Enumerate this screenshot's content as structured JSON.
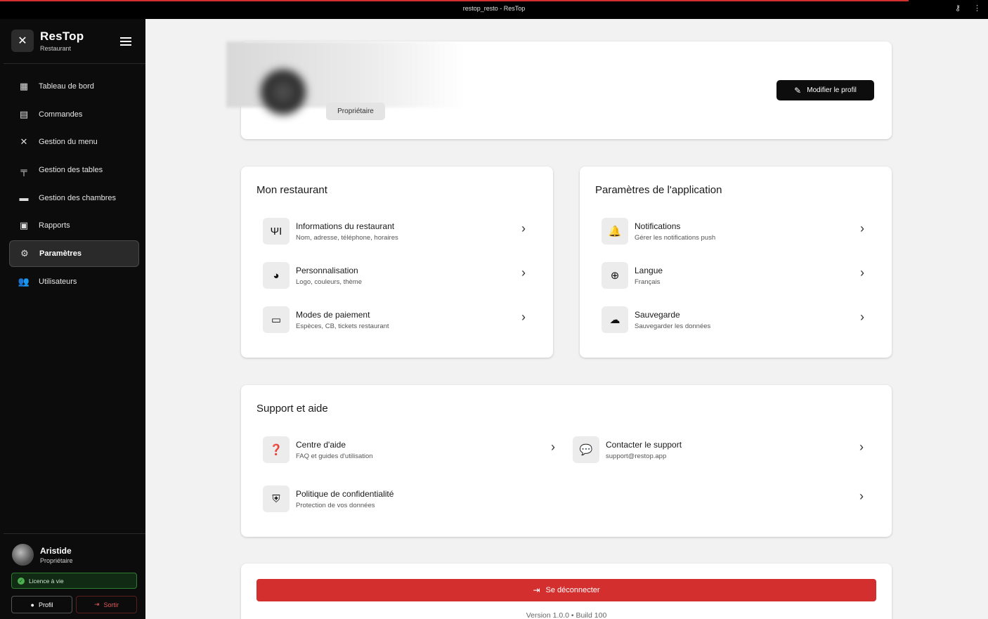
{
  "window": {
    "title": "restop_resto - ResTop"
  },
  "sidebar": {
    "brand_name": "ResTop",
    "brand_sub": "Restaurant",
    "items": [
      {
        "label": "Tableau de bord",
        "icon": "dashboard-icon"
      },
      {
        "label": "Commandes",
        "icon": "receipt-icon"
      },
      {
        "label": "Gestion du menu",
        "icon": "utensils-icon"
      },
      {
        "label": "Gestion des tables",
        "icon": "table-icon"
      },
      {
        "label": "Gestion des chambres",
        "icon": "bed-icon"
      },
      {
        "label": "Rapports",
        "icon": "chart-icon"
      },
      {
        "label": "Paramètres",
        "icon": "gear-icon",
        "active": true
      },
      {
        "label": "Utilisateurs",
        "icon": "users-icon"
      }
    ],
    "user": {
      "name": "Aristide",
      "role": "Propriétaire"
    },
    "licence": "Licence à vie",
    "profil_label": "Profil",
    "sortir_label": "Sortir"
  },
  "profile": {
    "role": "Propriétaire",
    "edit_label": "Modifier le profil"
  },
  "restaurant": {
    "title": "Mon restaurant",
    "rows": [
      {
        "title": "Informations du restaurant",
        "sub": "Nom, adresse, téléphone, horaires",
        "icon": "fork-knife-icon"
      },
      {
        "title": "Personnalisation",
        "sub": "Logo, couleurs, thème",
        "icon": "palette-icon"
      },
      {
        "title": "Modes de paiement",
        "sub": "Espèces, CB, tickets restaurant",
        "icon": "credit-card-icon"
      }
    ]
  },
  "app_settings": {
    "title": "Paramètres de l'application",
    "rows": [
      {
        "title": "Notifications",
        "sub": "Gérer les notifications push",
        "icon": "bell-icon"
      },
      {
        "title": "Langue",
        "sub": "Français",
        "icon": "globe-icon"
      },
      {
        "title": "Sauvegarde",
        "sub": "Sauvegarder les données",
        "icon": "cloud-upload-icon"
      }
    ]
  },
  "support": {
    "title": "Support et aide",
    "rows": [
      {
        "title": "Centre d'aide",
        "sub": "FAQ et guides d'utilisation",
        "icon": "help-icon"
      },
      {
        "title": "Contacter le support",
        "sub": "support@restop.app",
        "icon": "support-chat-icon"
      },
      {
        "title": "Politique de confidentialité",
        "sub": "Protection de vos données",
        "icon": "shield-icon"
      }
    ]
  },
  "logout": {
    "label": "Se déconnecter",
    "version": "Version 1.0.0 • Build 100"
  }
}
